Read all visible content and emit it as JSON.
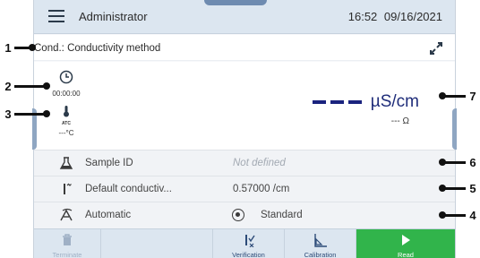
{
  "header": {
    "user": "Administrator",
    "time": "16:52",
    "date": "09/16/2021"
  },
  "method": {
    "name": "Cond.: Conductivity method"
  },
  "measurement": {
    "timer": "00:00:00",
    "atc": "ATC",
    "temperature": "---°C",
    "unit": "µS/cm",
    "secondary": "--- Ω"
  },
  "rows": {
    "sample_id": {
      "label": "Sample ID",
      "value": "Not defined"
    },
    "cell_constant": {
      "label": "Default conductiv...",
      "value": "0.57000 /cm"
    },
    "endpoint": {
      "label": "Automatic",
      "option": "Standard"
    }
  },
  "buttons": {
    "terminate": "Terminate",
    "verification": "Verification",
    "calibration": "Calibration",
    "read": "Read"
  },
  "callouts": {
    "c1": "1",
    "c2": "2",
    "c3": "3",
    "c4": "4",
    "c5": "5",
    "c6": "6",
    "c7": "7"
  },
  "colors": {
    "accent": "#31b44b",
    "header": "#dce6f0",
    "value": "#1a237e"
  }
}
